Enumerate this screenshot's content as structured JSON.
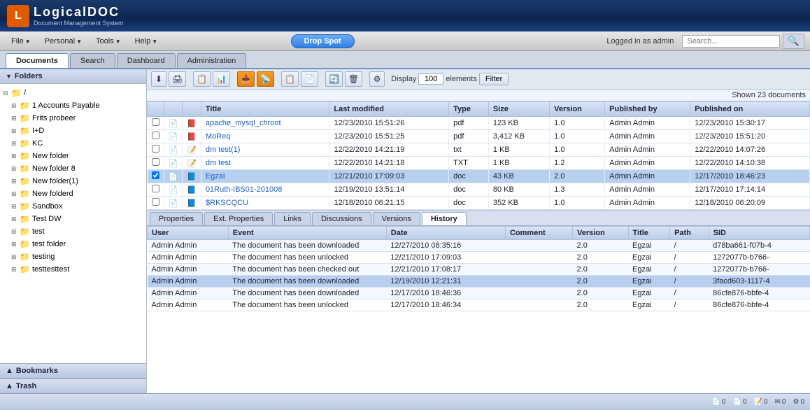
{
  "app": {
    "title": "LogicalDOC",
    "subtitle": "Document Management System",
    "logged_in": "Logged in as admin",
    "search_placeholder": "Search..."
  },
  "menubar": {
    "items": [
      "File",
      "Personal",
      "Tools",
      "Help"
    ],
    "drop_spot": "Drop Spot"
  },
  "tabs": {
    "main": [
      "Documents",
      "Search",
      "Dashboard",
      "Administration"
    ],
    "active": "Documents"
  },
  "sidebar": {
    "folders_label": "Folders",
    "tree": [
      {
        "label": "/",
        "level": 0,
        "expanded": true
      },
      {
        "label": "1 Accounts Payable",
        "level": 1
      },
      {
        "label": "Frits probeer",
        "level": 1
      },
      {
        "label": "I+D",
        "level": 1
      },
      {
        "label": "KC",
        "level": 1
      },
      {
        "label": "New folder",
        "level": 1
      },
      {
        "label": "New folder 8",
        "level": 1
      },
      {
        "label": "New folder(1)",
        "level": 1
      },
      {
        "label": "New folderd",
        "level": 1
      },
      {
        "label": "Sandbox",
        "level": 1
      },
      {
        "label": "Test DW",
        "level": 1
      },
      {
        "label": "test",
        "level": 1
      },
      {
        "label": "test folder",
        "level": 1
      },
      {
        "label": "testing",
        "level": 1
      },
      {
        "label": "testtesttest",
        "level": 1
      }
    ],
    "bookmarks_label": "Bookmarks",
    "trash_label": "Trash"
  },
  "toolbar": {
    "display_label": "Display",
    "display_value": "100",
    "elements_label": "elements",
    "filter_label": "Filter"
  },
  "documents": {
    "count_label": "Shown 23 documents",
    "columns": [
      "",
      "",
      "",
      "Title",
      "Last modified",
      "Type",
      "Size",
      "Version",
      "Published by",
      "Published on"
    ],
    "rows": [
      {
        "icon": "📄",
        "type_icon": "pdf",
        "title": "apache_mysql_chroot",
        "modified": "12/23/2010 15:51:26",
        "type": "pdf",
        "size": "123 KB",
        "version": "1.0",
        "published_by": "Admin Admin",
        "published_on": "12/23/2010 15:30:17",
        "selected": false
      },
      {
        "icon": "📄",
        "type_icon": "pdf",
        "title": "MoReq",
        "modified": "12/23/2010 15:51:25",
        "type": "pdf",
        "size": "3,412 KB",
        "version": "1.0",
        "published_by": "Admin Admin",
        "published_on": "12/23/2010 15:51:20",
        "selected": false
      },
      {
        "icon": "📄",
        "type_icon": "txt",
        "title": "dm test(1)",
        "modified": "12/22/2010 14:21:19",
        "type": "txt",
        "size": "1 KB",
        "version": "1.0",
        "published_by": "Admin Admin",
        "published_on": "12/22/2010 14:07:26",
        "selected": false
      },
      {
        "icon": "📄",
        "type_icon": "txt",
        "title": "dm test",
        "modified": "12/22/2010 14:21:18",
        "type": "TXT",
        "size": "1 KB",
        "version": "1.2",
        "published_by": "Admin Admin",
        "published_on": "12/22/2010 14:10:38",
        "selected": false
      },
      {
        "icon": "📄",
        "type_icon": "doc",
        "title": "Egzai",
        "modified": "12/21/2010 17:09:03",
        "type": "doc",
        "size": "43 KB",
        "version": "2.0",
        "published_by": "Admin Admin",
        "published_on": "12/17/2010 18:46:23",
        "selected": true
      },
      {
        "icon": "📄",
        "type_icon": "doc",
        "title": "01Ruth-IBS01-201008",
        "modified": "12/19/2010 13:51:14",
        "type": "doc",
        "size": "80 KB",
        "version": "1.3",
        "published_by": "Admin Admin",
        "published_on": "12/17/2010 17:14:14",
        "selected": false
      },
      {
        "icon": "📄",
        "type_icon": "doc",
        "title": "$RKSCQCU",
        "modified": "12/18/2010 06:21:15",
        "type": "doc",
        "size": "352 KB",
        "version": "1.0",
        "published_by": "Admin Admin",
        "published_on": "12/18/2010 06:20:09",
        "selected": false
      }
    ]
  },
  "detail_tabs": {
    "tabs": [
      "Properties",
      "Ext. Properties",
      "Links",
      "Discussions",
      "Versions",
      "History"
    ],
    "active": "History"
  },
  "history": {
    "columns": [
      "User",
      "Event",
      "Date",
      "Comment",
      "Version",
      "Title",
      "Path",
      "SID"
    ],
    "rows": [
      {
        "user": "Admin Admin",
        "event": "The document has been downloaded",
        "date": "12/27/2010 08:35:16",
        "comment": "",
        "version": "2.0",
        "title": "Egzai",
        "path": "/",
        "sid": "d78ba661-f07b-4",
        "highlighted": false
      },
      {
        "user": "Admin Admin",
        "event": "The document has been unlocked",
        "date": "12/21/2010 17:09:03",
        "comment": "",
        "version": "2.0",
        "title": "Egzai",
        "path": "/",
        "sid": "1272077b-b766-",
        "highlighted": false
      },
      {
        "user": "Admin Admin",
        "event": "The document has been checked out",
        "date": "12/21/2010 17:08:17",
        "comment": "",
        "version": "2.0",
        "title": "Egzai",
        "path": "/",
        "sid": "1272077b-b766-",
        "highlighted": false
      },
      {
        "user": "Admin Admin",
        "event": "The document has been downloaded",
        "date": "12/19/2010 12:21:31",
        "comment": "",
        "version": "2.0",
        "title": "Egzai",
        "path": "/",
        "sid": "3facd603-1117-4",
        "highlighted": true
      },
      {
        "user": "Admin Admin",
        "event": "The document has been downloaded",
        "date": "12/17/2010 18:46:36",
        "comment": "",
        "version": "2.0",
        "title": "Egzai",
        "path": "/",
        "sid": "86cfe876-bbfe-4",
        "highlighted": false
      },
      {
        "user": "Admin Admin",
        "event": "The document has been unlocked",
        "date": "12/17/2010 18:46:34",
        "comment": "",
        "version": "2.0",
        "title": "Egzai",
        "path": "/",
        "sid": "86cfe876-bbfe-4",
        "highlighted": false
      }
    ]
  },
  "statusbar": {
    "icons": [
      {
        "name": "docs-icon",
        "count": "0"
      },
      {
        "name": "alerts-icon",
        "count": "0"
      },
      {
        "name": "tasks-icon",
        "count": "0"
      },
      {
        "name": "messages-icon",
        "count": "0"
      },
      {
        "name": "settings-icon",
        "count": "0"
      }
    ]
  }
}
